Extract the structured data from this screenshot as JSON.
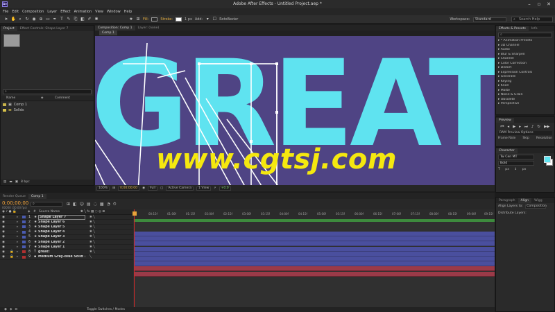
{
  "app": {
    "title": "Adobe After Effects - Untitled Project.aep *",
    "logo": "Ae"
  },
  "menu": [
    "File",
    "Edit",
    "Composition",
    "Layer",
    "Effect",
    "Animation",
    "View",
    "Window",
    "Help"
  ],
  "toolbar": {
    "fill_label": "Fill:",
    "stroke_label": "Stroke:",
    "stroke_width": "1 px",
    "add_label": "Add:",
    "rotobezier_label": "RotoBezier",
    "workspace_label": "Workspace:",
    "workspace_value": "Standard",
    "search_placeholder": "Search Help",
    "colors": {
      "fill": "#2a2a2a",
      "stroke": "#ffffff"
    }
  },
  "project_panel": {
    "tabs": [
      "Project",
      "Effect Controls: Shape Layer 7"
    ],
    "search_placeholder": "",
    "col_name": "Name",
    "col_comment": "Comment",
    "items": [
      {
        "name": "Comp 1",
        "color": "#c9b44a"
      },
      {
        "name": "Solids",
        "color": "#d8c24a"
      }
    ],
    "footer": "8 bpc"
  },
  "comp_panel": {
    "tabs": [
      "Composition: Comp 1",
      "Layer: (none)"
    ],
    "subtab": "Comp 1",
    "big_text": "GREAT!",
    "watermark": "www.cgtsj.com",
    "colors": {
      "bg": "#4f4484",
      "text": "#5fe3f0",
      "watermark": "#f5e80f"
    },
    "controls": {
      "zoom": "100%",
      "timecode": "0;00;00;00",
      "resolution": "Full",
      "camera": "Active Camera",
      "views": "1 View",
      "exposure": "+0.0"
    }
  },
  "effects_panel": {
    "tabs": [
      "Effects & Presets",
      "Info"
    ],
    "search_placeholder": "",
    "categories": [
      "* Animation Presets",
      "3D Channel",
      "Audio",
      "Blur & Sharpen",
      "Channel",
      "Color Correction",
      "Distort",
      "Expression Controls",
      "Generate",
      "Keying",
      "Knoll",
      "Matte",
      "Noise & Grain",
      "Obsolete",
      "Perspective"
    ]
  },
  "preview_panel": {
    "tab": "Preview",
    "ram_options": "RAM Preview Options",
    "frame_rate_label": "Frame Rate",
    "skip_label": "Skip",
    "resolution_label": "Resolution"
  },
  "character_panel": {
    "tab": "Character",
    "font": "Tw Cen MT",
    "style": "Bold",
    "size": "px",
    "leading": "px"
  },
  "align_panel": {
    "tabs": [
      "Paragraph",
      "Align",
      "Wigg"
    ],
    "align_to_label": "Align Layers to:",
    "align_to_value": "Composition",
    "distribute_label": "Distribute Layers:"
  },
  "timeline": {
    "tabs": [
      "Render Queue",
      "Comp 1"
    ],
    "timecode": "0;00;00;00",
    "timecode_sub": "00000 (30.00 fps)",
    "search_placeholder": "",
    "col_source": "Source Name",
    "ruler": [
      "00:15f",
      "01:00f",
      "01:15f",
      "02:00f",
      "02:15f",
      "03:00f",
      "03:15f",
      "04:00f",
      "04:15f",
      "05:00f",
      "05:15f",
      "06:00f",
      "06:15f",
      "07:00f",
      "07:15f",
      "08:00f",
      "08:15f",
      "09:00f",
      "09:15f"
    ],
    "layers": [
      {
        "num": "1",
        "name": "Shape Layer 7",
        "color": "#4a5bb0",
        "selected": true
      },
      {
        "num": "2",
        "name": "Shape Layer 6",
        "color": "#4a5bb0"
      },
      {
        "num": "3",
        "name": "Shape Layer 5",
        "color": "#4a5bb0"
      },
      {
        "num": "4",
        "name": "Shape Layer 4",
        "color": "#4a5bb0"
      },
      {
        "num": "5",
        "name": "Shape Layer 3",
        "color": "#4a5bb0"
      },
      {
        "num": "6",
        "name": "Shape Layer 2",
        "color": "#4a5bb0"
      },
      {
        "num": "7",
        "name": "Shape Layer 1",
        "color": "#4a5bb0"
      },
      {
        "num": "8",
        "name": "great!",
        "color": "#b03030"
      },
      {
        "num": "9",
        "name": "Medium Gray-Blue Solid 1",
        "color": "#b03030"
      }
    ],
    "footer": "Toggle Switches / Modes"
  }
}
